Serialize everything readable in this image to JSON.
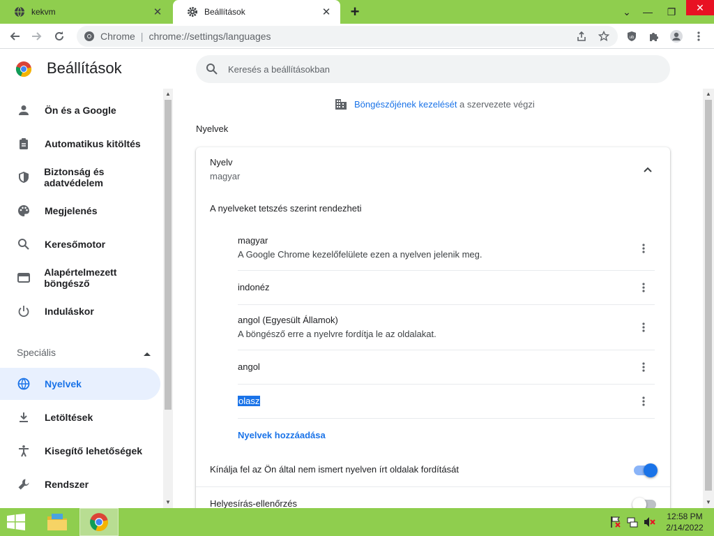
{
  "browser": {
    "tabs": [
      {
        "title": "kekvm",
        "favicon": "globe-icon"
      },
      {
        "title": "Beállítások",
        "favicon": "gear-icon"
      }
    ],
    "omnibox": {
      "site": "Chrome",
      "url": "chrome://settings/languages"
    }
  },
  "settings": {
    "title": "Beállítások",
    "search_placeholder": "Keresés a beállításokban",
    "sidebar": {
      "items": [
        {
          "label": "Ön és a Google",
          "icon": "person-icon"
        },
        {
          "label": "Automatikus kitöltés",
          "icon": "clipboard-icon"
        },
        {
          "label": "Biztonság és adatvédelem",
          "icon": "shield-icon"
        },
        {
          "label": "Megjelenés",
          "icon": "palette-icon"
        },
        {
          "label": "Keresőmotor",
          "icon": "search-icon"
        },
        {
          "label": "Alapértelmezett böngésző",
          "icon": "browser-icon"
        },
        {
          "label": "Induláskor",
          "icon": "power-icon"
        }
      ],
      "advanced_label": "Speciális",
      "advanced_items": [
        {
          "label": "Nyelvek",
          "icon": "globe-icon",
          "selected": true
        },
        {
          "label": "Letöltések",
          "icon": "download-icon"
        },
        {
          "label": "Kisegítő lehetőségek",
          "icon": "accessibility-icon"
        },
        {
          "label": "Rendszer",
          "icon": "wrench-icon"
        }
      ]
    },
    "managed": {
      "link": "Böngészőjének kezelését",
      "rest": " a szervezete végzi"
    },
    "section_title": "Nyelvek",
    "language_card": {
      "heading": "Nyelv",
      "current": "magyar",
      "reorder_hint": "A nyelveket tetszés szerint rendezheti",
      "languages": [
        {
          "name": "magyar",
          "desc": "A Google Chrome kezelőfelülete ezen a nyelven jelenik meg."
        },
        {
          "name": "indonéz",
          "desc": ""
        },
        {
          "name": "angol (Egyesült Államok)",
          "desc": "A böngésző erre a nyelvre fordítja le az oldalakat."
        },
        {
          "name": "angol",
          "desc": ""
        },
        {
          "name": "olasz",
          "desc": ""
        }
      ],
      "add_label": "Nyelvek hozzáadása",
      "translate_label": "Kínálja fel az Ön által nem ismert nyelven írt oldalak fordítását",
      "translate_on": true,
      "spellcheck_label": "Helyesírás-ellenőrzés",
      "spellcheck_on": false
    }
  },
  "taskbar": {
    "time": "12:58 PM",
    "date": "2/14/2022"
  },
  "colors": {
    "accent": "#1a73e8",
    "titlebar": "#8fce4e",
    "selected_bg": "#e8f0fe"
  }
}
